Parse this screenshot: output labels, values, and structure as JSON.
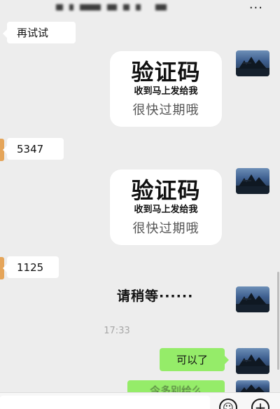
{
  "chat": {
    "title_masked": true,
    "messages": [
      {
        "id": "m1",
        "side": "left",
        "type": "text",
        "text": "再试试"
      },
      {
        "id": "m2",
        "side": "right",
        "type": "sticker",
        "line1": "验证码",
        "line2": "收到马上发给我",
        "line3": "很快过期哦"
      },
      {
        "id": "m3",
        "side": "left",
        "type": "text",
        "text": "5347"
      },
      {
        "id": "m4",
        "side": "right",
        "type": "sticker",
        "line1": "验证码",
        "line2": "收到马上发给我",
        "line3": "很快过期哦"
      },
      {
        "id": "m5",
        "side": "left",
        "type": "text",
        "text": "1125"
      },
      {
        "id": "m6",
        "side": "right",
        "type": "sticker-text",
        "text": "请稍等······"
      },
      {
        "id": "ts",
        "type": "timestamp",
        "text": "17:33"
      },
      {
        "id": "m7",
        "side": "right",
        "type": "text",
        "text": "可以了"
      },
      {
        "id": "m8",
        "side": "right",
        "type": "text-partial",
        "text": "今多别给么"
      }
    ]
  },
  "icons": {
    "more": "ellipsis-icon",
    "emoji": "emoji-icon",
    "plus": "plus-icon"
  },
  "colors": {
    "background": "#ededed",
    "bubble_self": "#95ec69",
    "bubble_other": "#ffffff"
  }
}
